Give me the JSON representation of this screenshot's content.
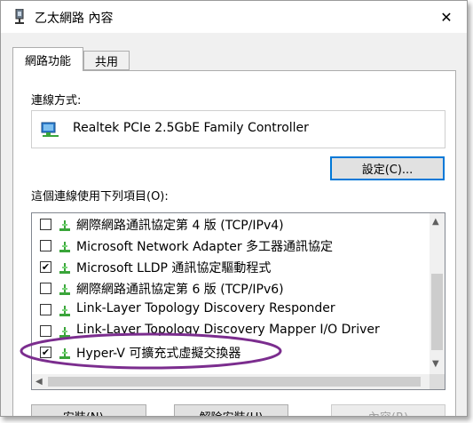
{
  "window": {
    "title": "乙太網路 內容",
    "close_glyph": "✕"
  },
  "tabs": [
    {
      "label": "網路功能",
      "active": true
    },
    {
      "label": "共用",
      "active": false
    }
  ],
  "connect_using": {
    "label": "連線方式:",
    "adapter": "Realtek PCIe 2.5GbE Family Controller"
  },
  "configure_button": "設定(C)...",
  "items": {
    "label": "這個連線使用下列項目(O):",
    "list": [
      {
        "checked": false,
        "text": "網際網路通訊協定第 4 版 (TCP/IPv4)"
      },
      {
        "checked": false,
        "text": "Microsoft Network Adapter 多工器通訊協定"
      },
      {
        "checked": true,
        "text": "Microsoft LLDP 通訊協定驅動程式"
      },
      {
        "checked": false,
        "text": "網際網路通訊協定第 6 版 (TCP/IPv6)"
      },
      {
        "checked": false,
        "text": "Link-Layer Topology Discovery Responder"
      },
      {
        "checked": false,
        "text": "Link-Layer Topology Discovery Mapper I/O Driver"
      },
      {
        "checked": true,
        "text": "Hyper-V 可擴充式虛擬交換器"
      }
    ],
    "check_glyph": "✔"
  },
  "buttons": {
    "install": "安裝(N)...",
    "uninstall": "解除安裝(U)",
    "properties": "內容(R)"
  },
  "colors": {
    "accent": "#0078d7",
    "annotation": "#7b2d8e",
    "network_icon": "#3aa53a"
  },
  "icons": {
    "title": "network-adapter-icon",
    "adapter": "network-card-icon",
    "item": "network-component-icon"
  }
}
